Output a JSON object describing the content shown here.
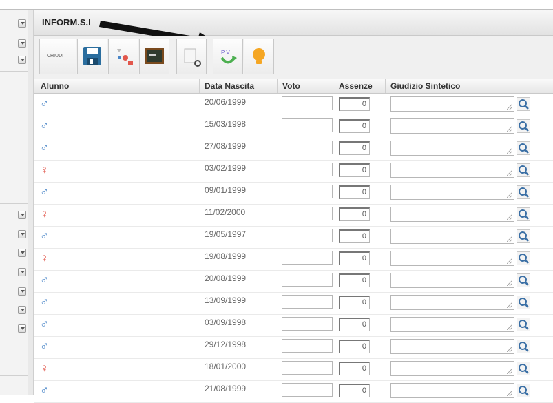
{
  "window": {
    "title": "INFORM.S.I"
  },
  "toolbar": {
    "buttons": [
      {
        "name": "close-button",
        "label": "CHIUDI"
      },
      {
        "name": "save-button",
        "label": ""
      },
      {
        "name": "colors-button",
        "label": ""
      },
      {
        "name": "blackboard-button",
        "label": ""
      },
      {
        "name": "settings-button",
        "label": ""
      },
      {
        "name": "pv-button",
        "label": "P V"
      },
      {
        "name": "idea-button",
        "label": ""
      }
    ]
  },
  "table": {
    "headers": {
      "alunno": "Alunno",
      "data": "Data Nascita",
      "voto": "Voto",
      "assenze": "Assenze",
      "giudizio": "Giudizio Sintetico"
    },
    "rows": [
      {
        "gender": "♂",
        "date": "20/06/1999",
        "assenze": "0"
      },
      {
        "gender": "♂",
        "date": "15/03/1998",
        "assenze": "0"
      },
      {
        "gender": "♂",
        "date": "27/08/1999",
        "assenze": "0"
      },
      {
        "gender": "♀",
        "date": "03/02/1999",
        "assenze": "0"
      },
      {
        "gender": "♂",
        "date": "09/01/1999",
        "assenze": "0"
      },
      {
        "gender": "♀",
        "date": "11/02/2000",
        "assenze": "0"
      },
      {
        "gender": "♂",
        "date": "19/05/1997",
        "assenze": "0"
      },
      {
        "gender": "♀",
        "date": "19/08/1999",
        "assenze": "0"
      },
      {
        "gender": "♂",
        "date": "20/08/1999",
        "assenze": "0"
      },
      {
        "gender": "♂",
        "date": "13/09/1999",
        "assenze": "0"
      },
      {
        "gender": "♂",
        "date": "03/09/1998",
        "assenze": "0"
      },
      {
        "gender": "♂",
        "date": "29/12/1998",
        "assenze": "0"
      },
      {
        "gender": "♀",
        "date": "18/01/2000",
        "assenze": "0"
      },
      {
        "gender": "♂",
        "date": "21/08/1999",
        "assenze": "0"
      }
    ]
  },
  "colors": {
    "male": "#4a86c8",
    "female": "#e2574c",
    "border": "#c9c9c9"
  }
}
